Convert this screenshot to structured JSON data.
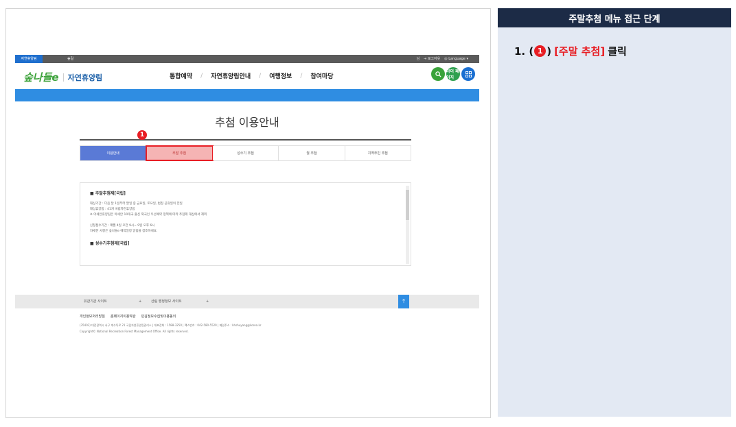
{
  "guide": {
    "title": "주말추첨 메뉴 접근 단계",
    "step": {
      "prefix": "1. (",
      "badge": "1",
      "suffix": ")",
      "target": "[주말 추첨]",
      "action": "클릭"
    }
  },
  "site": {
    "topbar": {
      "home": "자연휴양림",
      "forest": "숲길",
      "user": "님",
      "logout": "로그아웃",
      "language": "Language"
    },
    "logo": "숲나들e",
    "name": "자연휴양림",
    "nav": [
      "통합예약",
      "자연휴양림안내",
      "여행정보",
      "참여마당"
    ],
    "icons": {
      "search": "search-icon",
      "myinfo_label": "마이 페이지",
      "menu": "grid-menu-icon"
    },
    "page_title": "추첨 이용안내",
    "tabs": [
      "이용안내",
      "주말 추첨",
      "성수기 추첨",
      "월 추첨",
      "지역주민 추첨"
    ],
    "active_tab": 0,
    "highlight_tab": 1,
    "badge": "1",
    "info": {
      "heading1": "■ 주말추첨제[국립]",
      "lines1": [
        "대상기간 : 다음 달 1일부터 말일 중 금요일, 토요일, 법정 공휴일의 전일",
        "대상휴양림 : 41개 국립자연휴양림",
        "※ 아세안휴양림은 아세안 10개국 출신 외국인 우선예약 정책에 따라 추첨제 대상에서 제외"
      ],
      "lines2": [
        "신청접수기간 : 매월 4일 오전 9시~ 9일 오후 6시",
        "자세한 사항은 숲나들e 예약일정 알림을 참조하세요."
      ],
      "heading2": "■ 성수기추첨제[국립]"
    },
    "footer": {
      "related": "유관기관 사이트",
      "plus1": "+",
      "admin": "산림 행정정보 사이트",
      "plus2": "+",
      "top": "TOP",
      "links": [
        "개인정보처리방침",
        "홈페이지이용약관",
        "민감정보수집및이용동의"
      ],
      "address": "(35403) 대전광역시 서구 계수독로 21 국립자연휴양림관리소 | 대표전화 : 1588-3250 | 팩스번호 : 042-580-5529 | 메일주소 : khshuyang@korea.kr",
      "copyright": "Copyright© National Recreation Forest Management Office. All rights reserved."
    }
  },
  "colors": {
    "accent_red": "#e81e24",
    "navy": "#1c2b46",
    "panel_bg": "#e3e9f3",
    "site_blue": "#2f8de2",
    "tab_active": "#5a7ad6"
  }
}
